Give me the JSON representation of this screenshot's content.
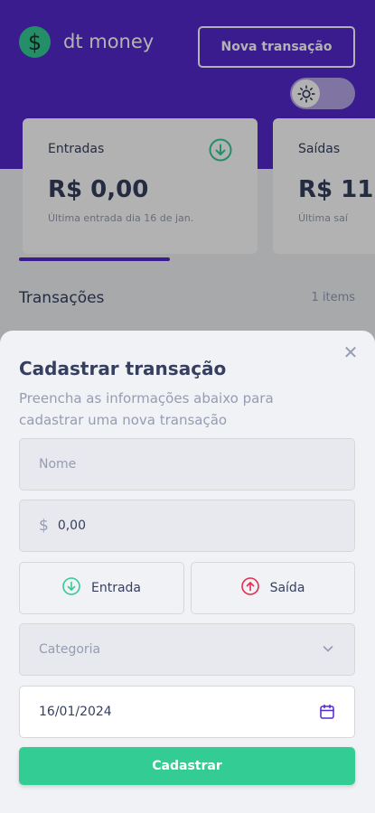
{
  "app": {
    "brand": "dt money",
    "logo_glyph": "$",
    "new_transaction_label": "Nova transação",
    "theme_toggle_icon": "sun-icon"
  },
  "summary_cards": [
    {
      "title": "Entradas",
      "icon": "arrow-down-circle-icon",
      "value": "R$ 0,00",
      "subtitle": "Última entrada dia 16 de jan."
    },
    {
      "title": "Saídas",
      "value": "R$ 11",
      "subtitle": "Última saí"
    }
  ],
  "transactions": {
    "title": "Transações",
    "count": "1 items"
  },
  "modal": {
    "title": "Cadastrar transação",
    "description": "Preencha as informações abaixo para cadastrar uma nova transação",
    "name_placeholder": "Nome",
    "currency_symbol": "$",
    "amount_value": "0,00",
    "type_income_label": "Entrada",
    "type_outcome_label": "Saída",
    "category_placeholder": "Categoria",
    "date_value": "16/01/2024",
    "submit_label": "Cadastrar",
    "close_icon": "close-icon"
  },
  "colors": {
    "primary": "#5429cc",
    "green": "#33cc95",
    "red": "#e52e4d",
    "text": "#363f5f",
    "muted": "#969cb2",
    "background": "#f0f2f5"
  }
}
